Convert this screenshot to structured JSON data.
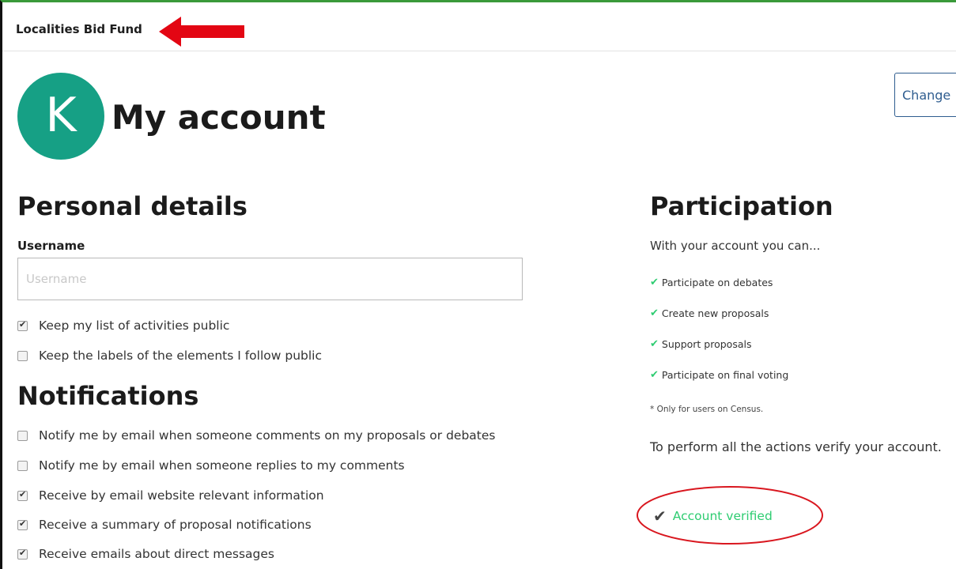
{
  "site": {
    "name": "Localities Bid Fund"
  },
  "account": {
    "avatar_letter": "K",
    "title": "My account",
    "change_button": "Change"
  },
  "personal": {
    "heading": "Personal details",
    "username_label": "Username",
    "username_placeholder": "Username",
    "options": [
      {
        "label": "Keep my list of activities public",
        "checked": true
      },
      {
        "label": "Keep the labels of the elements I follow public",
        "checked": false
      }
    ]
  },
  "notifications": {
    "heading": "Notifications",
    "options": [
      {
        "label": "Notify me by email when someone comments on my proposals or debates",
        "checked": false
      },
      {
        "label": "Notify me by email when someone replies to my comments",
        "checked": false
      },
      {
        "label": "Receive by email website relevant information",
        "checked": true
      },
      {
        "label": "Receive a summary of proposal notifications",
        "checked": true
      },
      {
        "label": "Receive emails about direct messages",
        "checked": true
      }
    ]
  },
  "participation": {
    "heading": "Participation",
    "intro": "With your account you can...",
    "permissions": [
      "Participate on debates",
      "Create new proposals",
      "Support proposals",
      "Participate on final voting"
    ],
    "note": "* Only for users on Census.",
    "perform_text": "To perform all the actions verify your account.",
    "verified_label": "Account verified"
  },
  "annotations": {
    "arrow_color": "#e30613",
    "ellipse_color": "#d9171f"
  },
  "colors": {
    "avatar": "#16a085",
    "check_green": "#2ecc71",
    "button_blue": "#2f5d8f"
  }
}
